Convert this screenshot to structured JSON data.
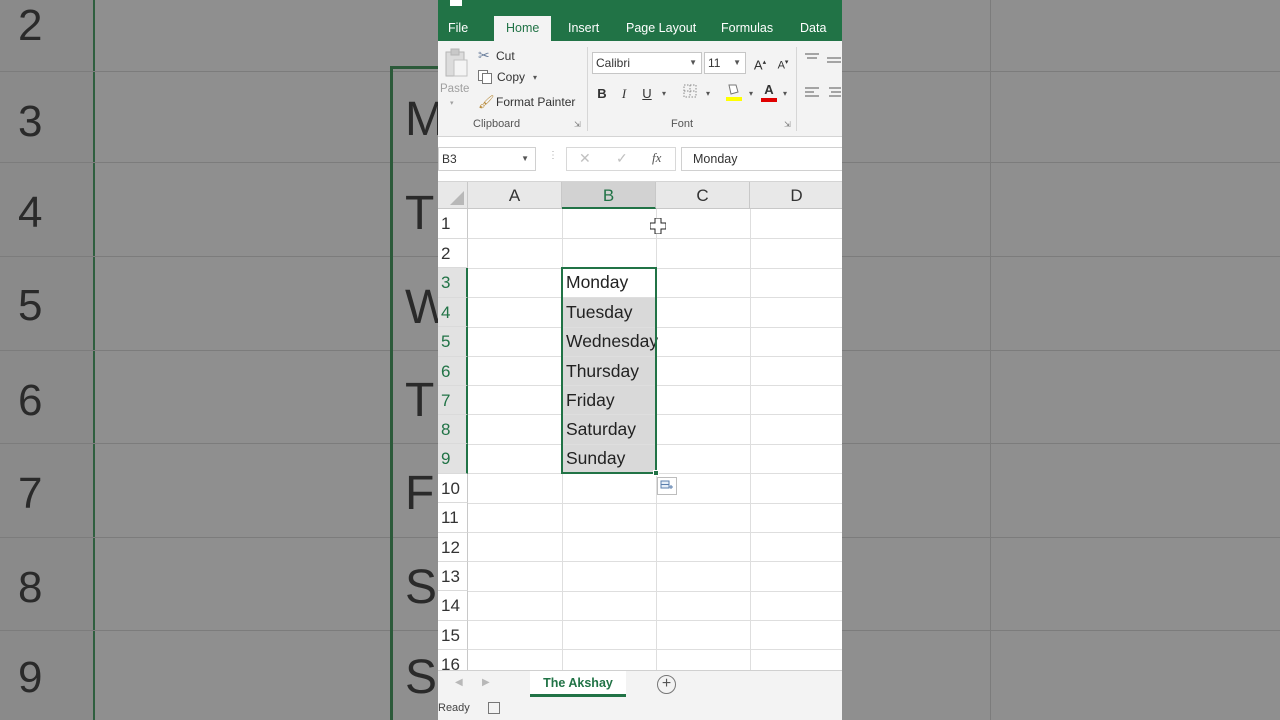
{
  "background": {
    "row_numbers": [
      "2",
      "3",
      "4",
      "5",
      "6",
      "7",
      "8",
      "9"
    ],
    "cell_letters": [
      "M",
      "T",
      "W",
      "T",
      "F",
      "S",
      "S"
    ]
  },
  "ribbon_tabs": [
    "File",
    "Home",
    "Insert",
    "Page Layout",
    "Formulas",
    "Data"
  ],
  "active_tab": "Home",
  "clipboard": {
    "paste_label": "Paste",
    "cut_label": "Cut",
    "copy_label": "Copy",
    "format_painter_label": "Format Painter",
    "group_label": "Clipboard"
  },
  "font": {
    "font_name": "Calibri",
    "font_size": "11",
    "bold": "B",
    "italic": "I",
    "underline": "U",
    "grow": "A",
    "shrink": "A",
    "font_color_glyph": "A",
    "group_label": "Font"
  },
  "formula_bar": {
    "name_box": "B3",
    "fx_label": "fx",
    "cancel_glyph": "✕",
    "enter_glyph": "✓",
    "value": "Monday"
  },
  "columns": [
    "A",
    "B",
    "C",
    "D"
  ],
  "selected_column": "B",
  "rows": [
    "1",
    "2",
    "3",
    "4",
    "5",
    "6",
    "7",
    "8",
    "9",
    "10",
    "11",
    "12",
    "13",
    "14",
    "15",
    "16"
  ],
  "selected_rows": [
    "3",
    "4",
    "5",
    "6",
    "7",
    "8",
    "9"
  ],
  "cells": {
    "B3": "Monday",
    "B4": "Tuesday",
    "B5": "Wednesday",
    "B6": "Thursday",
    "B7": "Friday",
    "B8": "Saturday",
    "B9": "Sunday"
  },
  "sheet": {
    "tab_name": "The Akshay",
    "add_glyph": "+"
  },
  "status": {
    "text": "Ready"
  },
  "colors": {
    "excel_green": "#217346",
    "selection_fill": "#d9d9d9"
  }
}
